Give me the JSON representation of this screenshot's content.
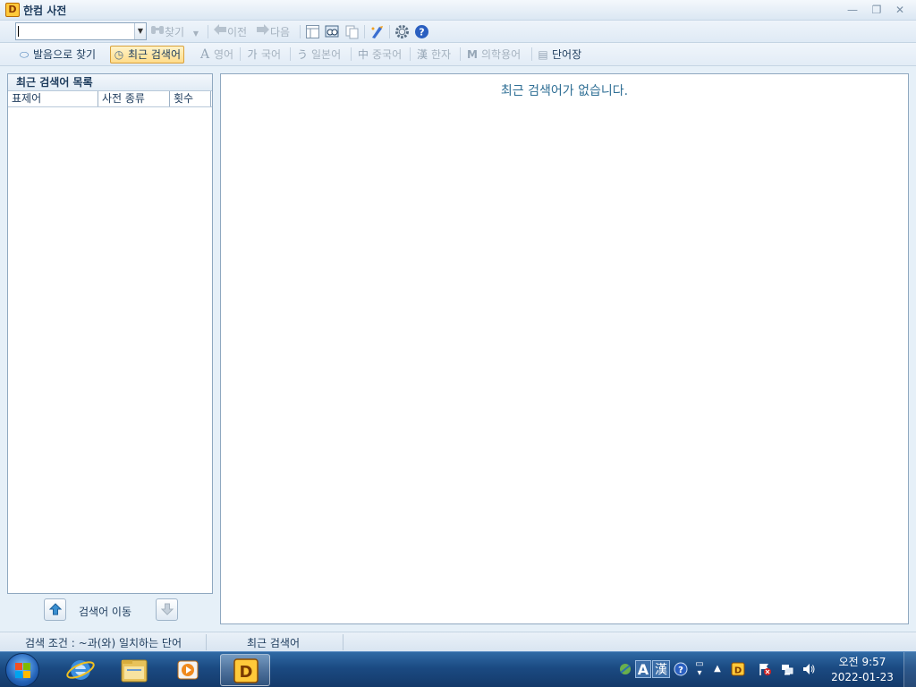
{
  "window": {
    "logo_letter": "D",
    "title": "한컴 사전",
    "minimize_glyph": "—",
    "restore_glyph": "❐",
    "close_glyph": "✕"
  },
  "toolbar": {
    "search_value": "",
    "find_label": "찾기",
    "prev_label": "이전",
    "next_label": "다음"
  },
  "dict_tabs": [
    {
      "label": "발음으로 찾기",
      "icon": "lips-icon",
      "glyph": "⬭",
      "enabled": true
    },
    {
      "label": "최근 검색어",
      "icon": "recent-search-icon",
      "glyph": "◷",
      "active": true,
      "enabled": true
    },
    {
      "label": "영어",
      "icon": "english-icon",
      "glyph": "A",
      "enabled": false
    },
    {
      "label": "국어",
      "icon": "korean-icon",
      "glyph": "가",
      "enabled": false
    },
    {
      "label": "일본어",
      "icon": "japanese-icon",
      "glyph": "う",
      "enabled": false
    },
    {
      "label": "중국어",
      "icon": "chinese-icon",
      "glyph": "中",
      "enabled": false
    },
    {
      "label": "한자",
      "icon": "hanja-icon",
      "glyph": "漢",
      "enabled": false
    },
    {
      "label": "의학용어",
      "icon": "medical-icon",
      "glyph": "M",
      "enabled": false
    },
    {
      "label": "단어장",
      "icon": "wordbook-icon",
      "glyph": "▤",
      "enabled": true
    }
  ],
  "recent_panel": {
    "title": "최근 검색어 목록",
    "columns": [
      "표제어",
      "사전 종류",
      "횟수"
    ],
    "rows": [],
    "move_label": "검색어 이동"
  },
  "content": {
    "empty_message": "최근 검색어가 없습니다."
  },
  "status": {
    "condition": "검색 조건 : ~과(와) 일치하는 단어",
    "mode": "최근 검색어"
  },
  "taskbar": {
    "ime_a": "A",
    "ime_han": "漢",
    "clock_time": "오전 9:57",
    "clock_date": "2022-01-23"
  },
  "colors": {
    "accent": "#2f6f95",
    "active_tab": "#ffdc8a",
    "taskbar": "#1b4a82"
  }
}
